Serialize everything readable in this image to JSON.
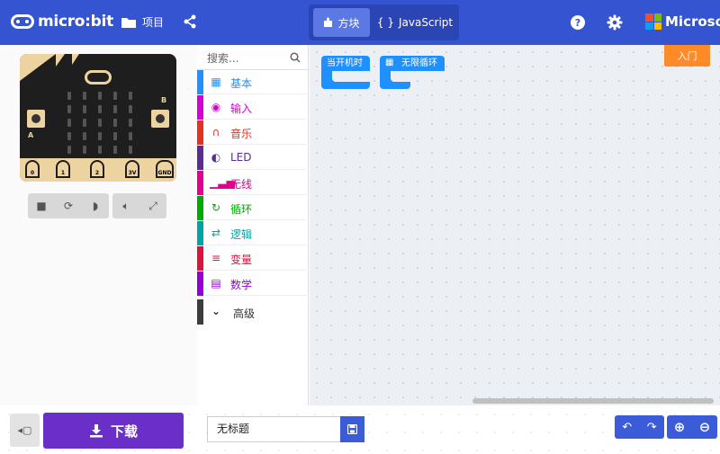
{
  "header": {
    "logo_text": "micro:bit",
    "projects_label": "项目",
    "blocks_label": "方块",
    "javascript_label": "JavaScript",
    "microsoft_label": "Microsoft",
    "colors": {
      "bar": "#3454d1",
      "segment": "#2b45b4",
      "active": "#5b78e4"
    }
  },
  "simulator": {
    "pins": [
      "0",
      "1",
      "2",
      "3V",
      "GND"
    ],
    "button_a": "A",
    "button_b": "B"
  },
  "toolbox": {
    "search_placeholder": "搜索...",
    "categories": [
      {
        "label": "基本",
        "color": "#1e90ff",
        "icon": "grid-icon"
      },
      {
        "label": "输入",
        "color": "#d400d4",
        "icon": "target-icon"
      },
      {
        "label": "音乐",
        "color": "#e63022",
        "icon": "headphones-icon"
      },
      {
        "label": "LED",
        "color": "#5c2d91",
        "icon": "toggle-icon"
      },
      {
        "label": "无线",
        "color": "#e3008c",
        "icon": "signal-icon"
      },
      {
        "label": "循环",
        "color": "#00aa00",
        "icon": "refresh-icon"
      },
      {
        "label": "逻辑",
        "color": "#00a4a6",
        "icon": "shuffle-icon"
      },
      {
        "label": "变量",
        "color": "#dc143c",
        "icon": "list-icon"
      },
      {
        "label": "数学",
        "color": "#9400d3",
        "icon": "calculator-icon"
      }
    ],
    "advanced_label": "高级"
  },
  "workspace": {
    "blocks": [
      {
        "label": "当开机时",
        "color": "#1e90ff"
      },
      {
        "label": "无限循环",
        "color": "#1e90ff"
      }
    ],
    "entry_button": "入门"
  },
  "footer": {
    "download_label": "下载",
    "project_name": "无标题",
    "download_color": "#6a2fc9"
  }
}
